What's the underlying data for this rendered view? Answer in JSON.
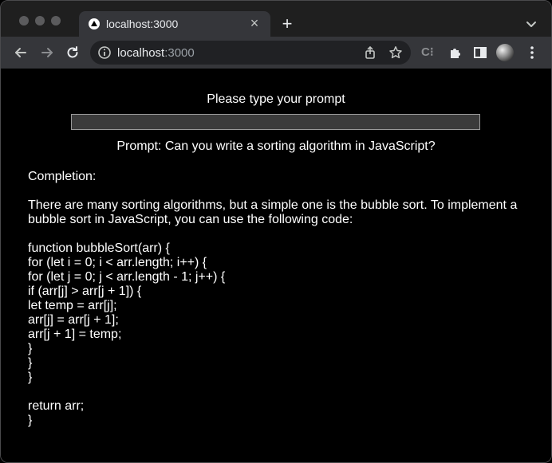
{
  "browser": {
    "tab_title": "localhost:3000",
    "url_host": "localhost",
    "url_port": ":3000"
  },
  "icons": {
    "tab_favicon": "triangle-logo-icon",
    "tab_close": "close-icon",
    "new_tab": "plus-icon",
    "tab_search": "chevron-down-icon",
    "back": "arrow-left-icon",
    "forward": "arrow-right-icon",
    "reload": "reload-icon",
    "site_info": "info-icon",
    "share": "share-icon",
    "bookmark": "star-icon",
    "extensions": "puzzle-icon",
    "sidebar": "sidebar-icon",
    "menu": "kebab-menu-icon"
  },
  "page": {
    "heading": "Please type your prompt",
    "input_value": "",
    "prompt_echo": "Prompt: Can you write a sorting algorithm in JavaScript?",
    "completion_label": "Completion:",
    "completion_intro": "There are many sorting algorithms, but a simple one is the bubble sort. To implement a bubble sort in JavaScript, you can use the following code:",
    "code_lines": [
      "function bubbleSort(arr) {",
      "for (let i = 0; i < arr.length; i++) {",
      "for (let j = 0; j < arr.length - 1; j++) {",
      "if (arr[j] > arr[j + 1]) {",
      "let temp = arr[j];",
      "arr[j] = arr[j + 1];",
      "arr[j + 1] = temp;",
      "}",
      "}",
      "}"
    ],
    "code_tail": [
      "return arr;",
      "}"
    ]
  }
}
